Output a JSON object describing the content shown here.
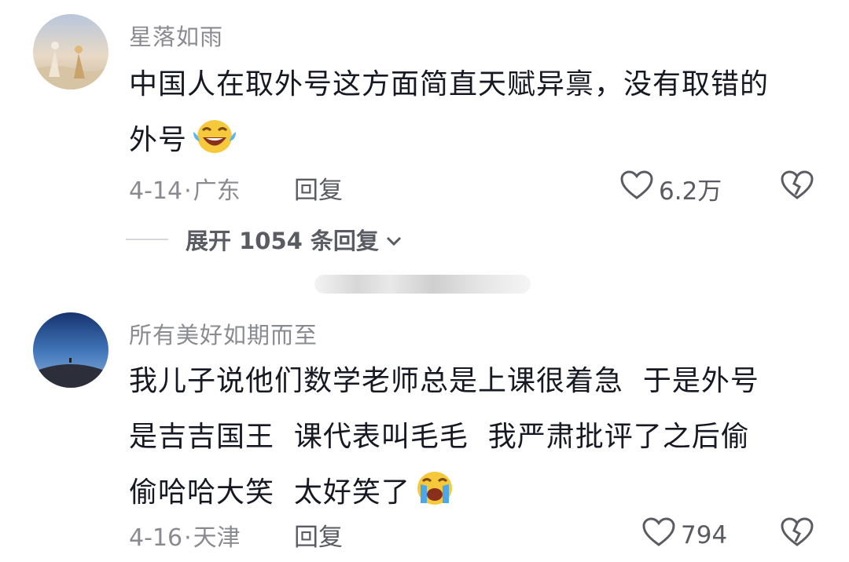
{
  "comments": [
    {
      "username": "星落如雨",
      "lines": [
        "中国人在取外号这方面简直天赋异禀，没有取错的",
        "外号"
      ],
      "emoji": "laughing-tears-emoji",
      "date": "4-14",
      "separator": "·",
      "location": "广东",
      "reply_label": "回复",
      "likes": "6.2万"
    },
    {
      "username": "所有美好如期而至",
      "lines": [
        "我儿子说他们数学老师总是上课很着急  于是外号",
        "是吉吉国王  课代表叫毛毛  我严肃批评了之后偷",
        "偷哈哈大笑  太好笑了"
      ],
      "emoji": "crying-face-emoji",
      "date": "4-16",
      "separator": "·",
      "location": "天津",
      "reply_label": "回复",
      "likes": "794"
    }
  ],
  "expand_replies": {
    "label": "展开 1054 条回复"
  },
  "icons": {
    "like": "heart-outline-icon",
    "dislike": "broken-heart-icon",
    "expand": "chevron-down-icon"
  },
  "colors": {
    "text": "#161823",
    "secondary": "#8a8b91",
    "action": "#5a5b63"
  }
}
